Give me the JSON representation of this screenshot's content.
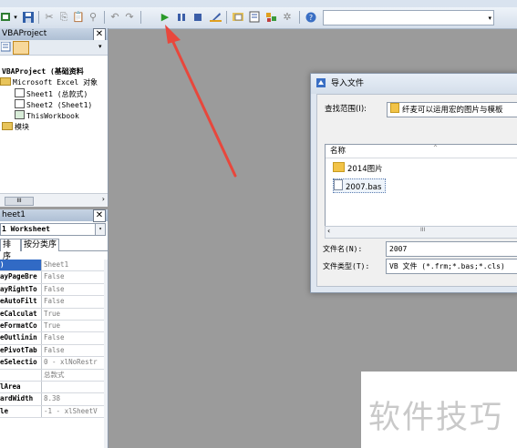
{
  "project_pane": {
    "title": "VBAProject",
    "tree": [
      {
        "label": "VBAProject (基础资料",
        "level": 0,
        "type": "project"
      },
      {
        "label": "Microsoft Excel 对象",
        "level": 1,
        "type": "folder"
      },
      {
        "label": "Sheet1 (总款式)",
        "level": 2,
        "type": "sheet"
      },
      {
        "label": "Sheet2 (Sheet1)",
        "level": 2,
        "type": "sheet"
      },
      {
        "label": "ThisWorkbook",
        "level": 2,
        "type": "workbook"
      },
      {
        "label": "模块",
        "level": 1,
        "type": "folder"
      }
    ],
    "scroll_thumb": "III"
  },
  "properties_pane": {
    "title": "heet1",
    "object_combo": "1 Worksheet",
    "tabs": [
      "排序",
      "按分类序"
    ],
    "rows": [
      {
        "name": ")",
        "value": "Sheet1",
        "selected": true
      },
      {
        "name": "ayPageBre",
        "value": "False"
      },
      {
        "name": "ayRightTo",
        "value": "False"
      },
      {
        "name": "eAutoFilt",
        "value": "False"
      },
      {
        "name": "eCalculat",
        "value": "True"
      },
      {
        "name": "eFormatCo",
        "value": "True"
      },
      {
        "name": "eOutlinin",
        "value": "False"
      },
      {
        "name": "ePivotTab",
        "value": "False"
      },
      {
        "name": "eSelectio",
        "value": "0 - xlNoRestr"
      },
      {
        "name": "",
        "value": "总款式"
      },
      {
        "name": "lArea",
        "value": ""
      },
      {
        "name": "ardWidth",
        "value": "8.38"
      },
      {
        "name": "le",
        "value": "-1 - xlSheetV"
      }
    ]
  },
  "dialog": {
    "title": "导入文件",
    "lookin_label": "查找范围(I):",
    "lookin_value": "纤麦可以运用宏的图片与模板",
    "column_name": "名称",
    "files": [
      {
        "name": "2014图片",
        "type": "folder"
      },
      {
        "name": "2007.bas",
        "type": "file",
        "selected": true
      }
    ],
    "scroll_thumb": "III",
    "filename_label": "文件名(N):",
    "filename_value": "2007",
    "filetype_label": "文件类型(T):",
    "filetype_value": "VB 文件 (*.frm;*.bas;*.cls)"
  },
  "watermark": "软件技巧",
  "colors": {
    "workspace": "#9b9b9b",
    "selection": "#316ac5",
    "arrow": "#e8473c"
  },
  "icons": [
    "excel-icon",
    "save-icon",
    "cut-icon",
    "copy-icon",
    "paste-icon",
    "find-icon",
    "undo-icon",
    "redo-icon",
    "run-icon",
    "break-icon",
    "reset-icon",
    "design-mode-icon",
    "project-explorer-icon",
    "properties-icon",
    "object-browser-icon",
    "toolbox-icon",
    "help-icon"
  ]
}
